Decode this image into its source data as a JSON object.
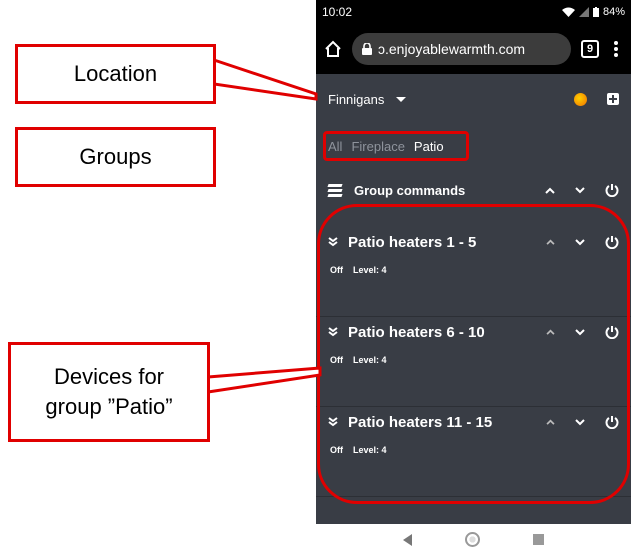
{
  "status_bar": {
    "time": "10:02",
    "battery": "84%"
  },
  "browser": {
    "url": "ɔ.enjoyablewarmth.com",
    "tab_count": "9"
  },
  "location": {
    "name": "Finnigans"
  },
  "group_tabs": [
    "All",
    "Fireplace",
    "Patio"
  ],
  "group_commands": {
    "label": "Group commands"
  },
  "devices": [
    {
      "name": "Patio heaters 1 - 5",
      "state": "Off",
      "level": "Level: 4"
    },
    {
      "name": "Patio heaters 6 - 10",
      "state": "Off",
      "level": "Level: 4"
    },
    {
      "name": "Patio heaters 11 - 15",
      "state": "Off",
      "level": "Level: 4"
    }
  ],
  "annotations": {
    "location": "Location",
    "groups": "Groups",
    "devices_line1": "Devices for",
    "devices_line2": "group ”Patio”"
  },
  "colors": {
    "app_bg": "#393d45",
    "annotation_red": "#e00000"
  }
}
